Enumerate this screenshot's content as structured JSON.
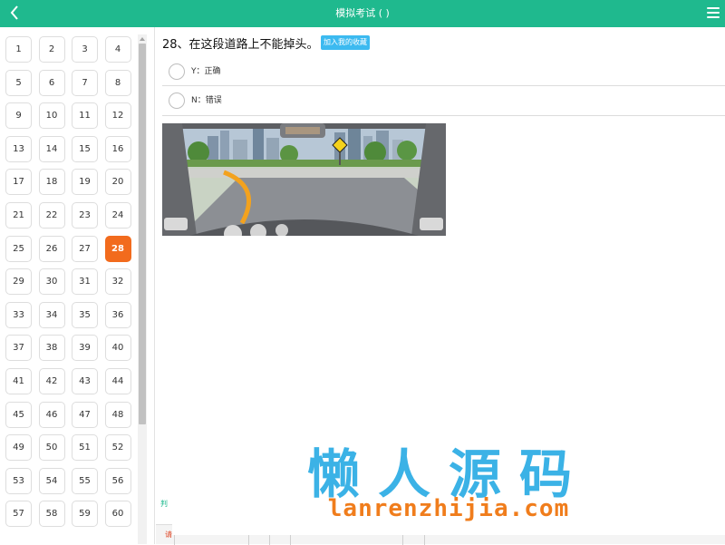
{
  "header": {
    "title": "模拟考试 ( )",
    "back_icon": "chevron-left-icon",
    "menu_icon": "hamburger-menu-icon"
  },
  "question_grid": {
    "numbers": [
      "1",
      "2",
      "3",
      "4",
      "5",
      "6",
      "7",
      "8",
      "9",
      "10",
      "11",
      "12",
      "13",
      "14",
      "15",
      "16",
      "17",
      "18",
      "19",
      "20",
      "21",
      "22",
      "23",
      "24",
      "25",
      "26",
      "27",
      "28",
      "29",
      "30",
      "31",
      "32",
      "33",
      "34",
      "35",
      "36",
      "37",
      "38",
      "39",
      "40",
      "41",
      "42",
      "43",
      "44",
      "45",
      "46",
      "47",
      "48",
      "49",
      "50",
      "51",
      "52",
      "53",
      "54",
      "55",
      "56",
      "57",
      "58",
      "59",
      "60"
    ],
    "current": "28"
  },
  "question": {
    "text": "28、在这段道路上不能掉头。",
    "favorite_label": "加入我的收藏",
    "options": [
      {
        "label": "Y：正确"
      },
      {
        "label": "N：错误"
      }
    ]
  },
  "side_tag": "判",
  "bottom_tag": "请",
  "watermark": {
    "title": "懒人源码",
    "url": "lanrenzhijia.com"
  },
  "colors": {
    "header": "#1fb98e",
    "active_cell": "#f26b1d",
    "favorite": "#3cbaf0",
    "watermark_title": "#3bb2e6",
    "watermark_url": "#f07d1c"
  }
}
